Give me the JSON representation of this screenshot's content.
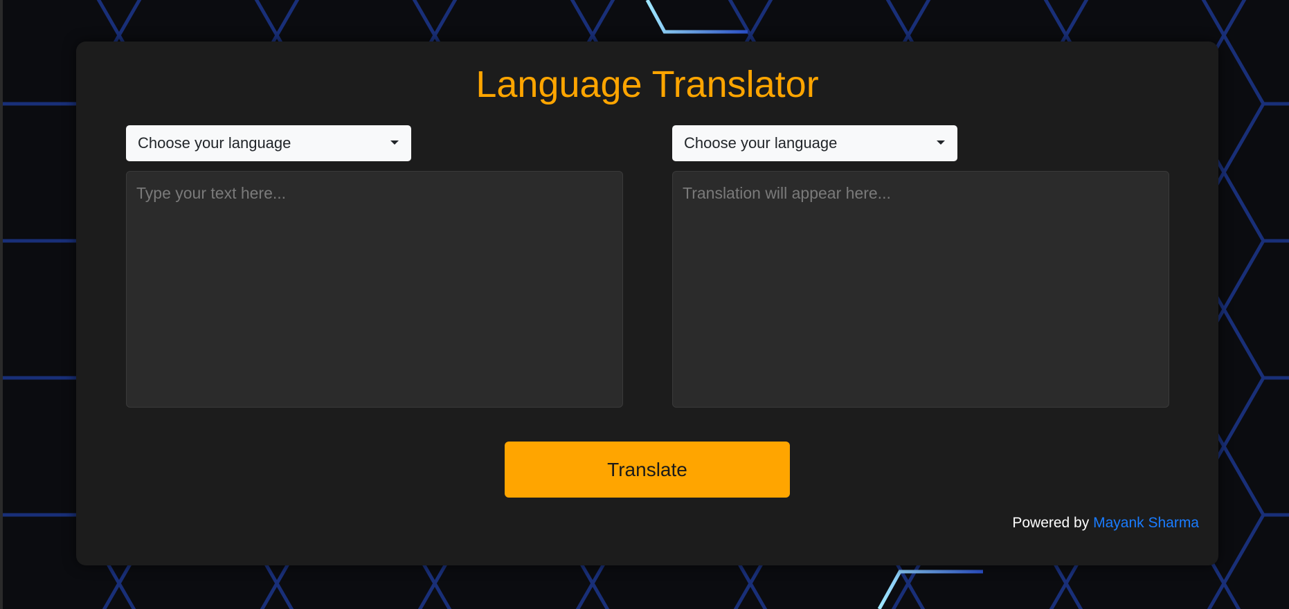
{
  "app": {
    "title": "Language Translator"
  },
  "source": {
    "language_select": "Choose your language",
    "text_placeholder": "Type your text here..."
  },
  "target": {
    "language_select": "Choose your language",
    "text_placeholder": "Translation will appear here..."
  },
  "actions": {
    "translate_label": "Translate"
  },
  "footer": {
    "powered_by": "Powered by",
    "author": "Mayank Sharma"
  },
  "colors": {
    "accent": "#ffa500",
    "card": "#1c1c1c",
    "link": "#1a7cff",
    "background": "#0b0c10",
    "hex_glow": "#2a4fc9"
  }
}
